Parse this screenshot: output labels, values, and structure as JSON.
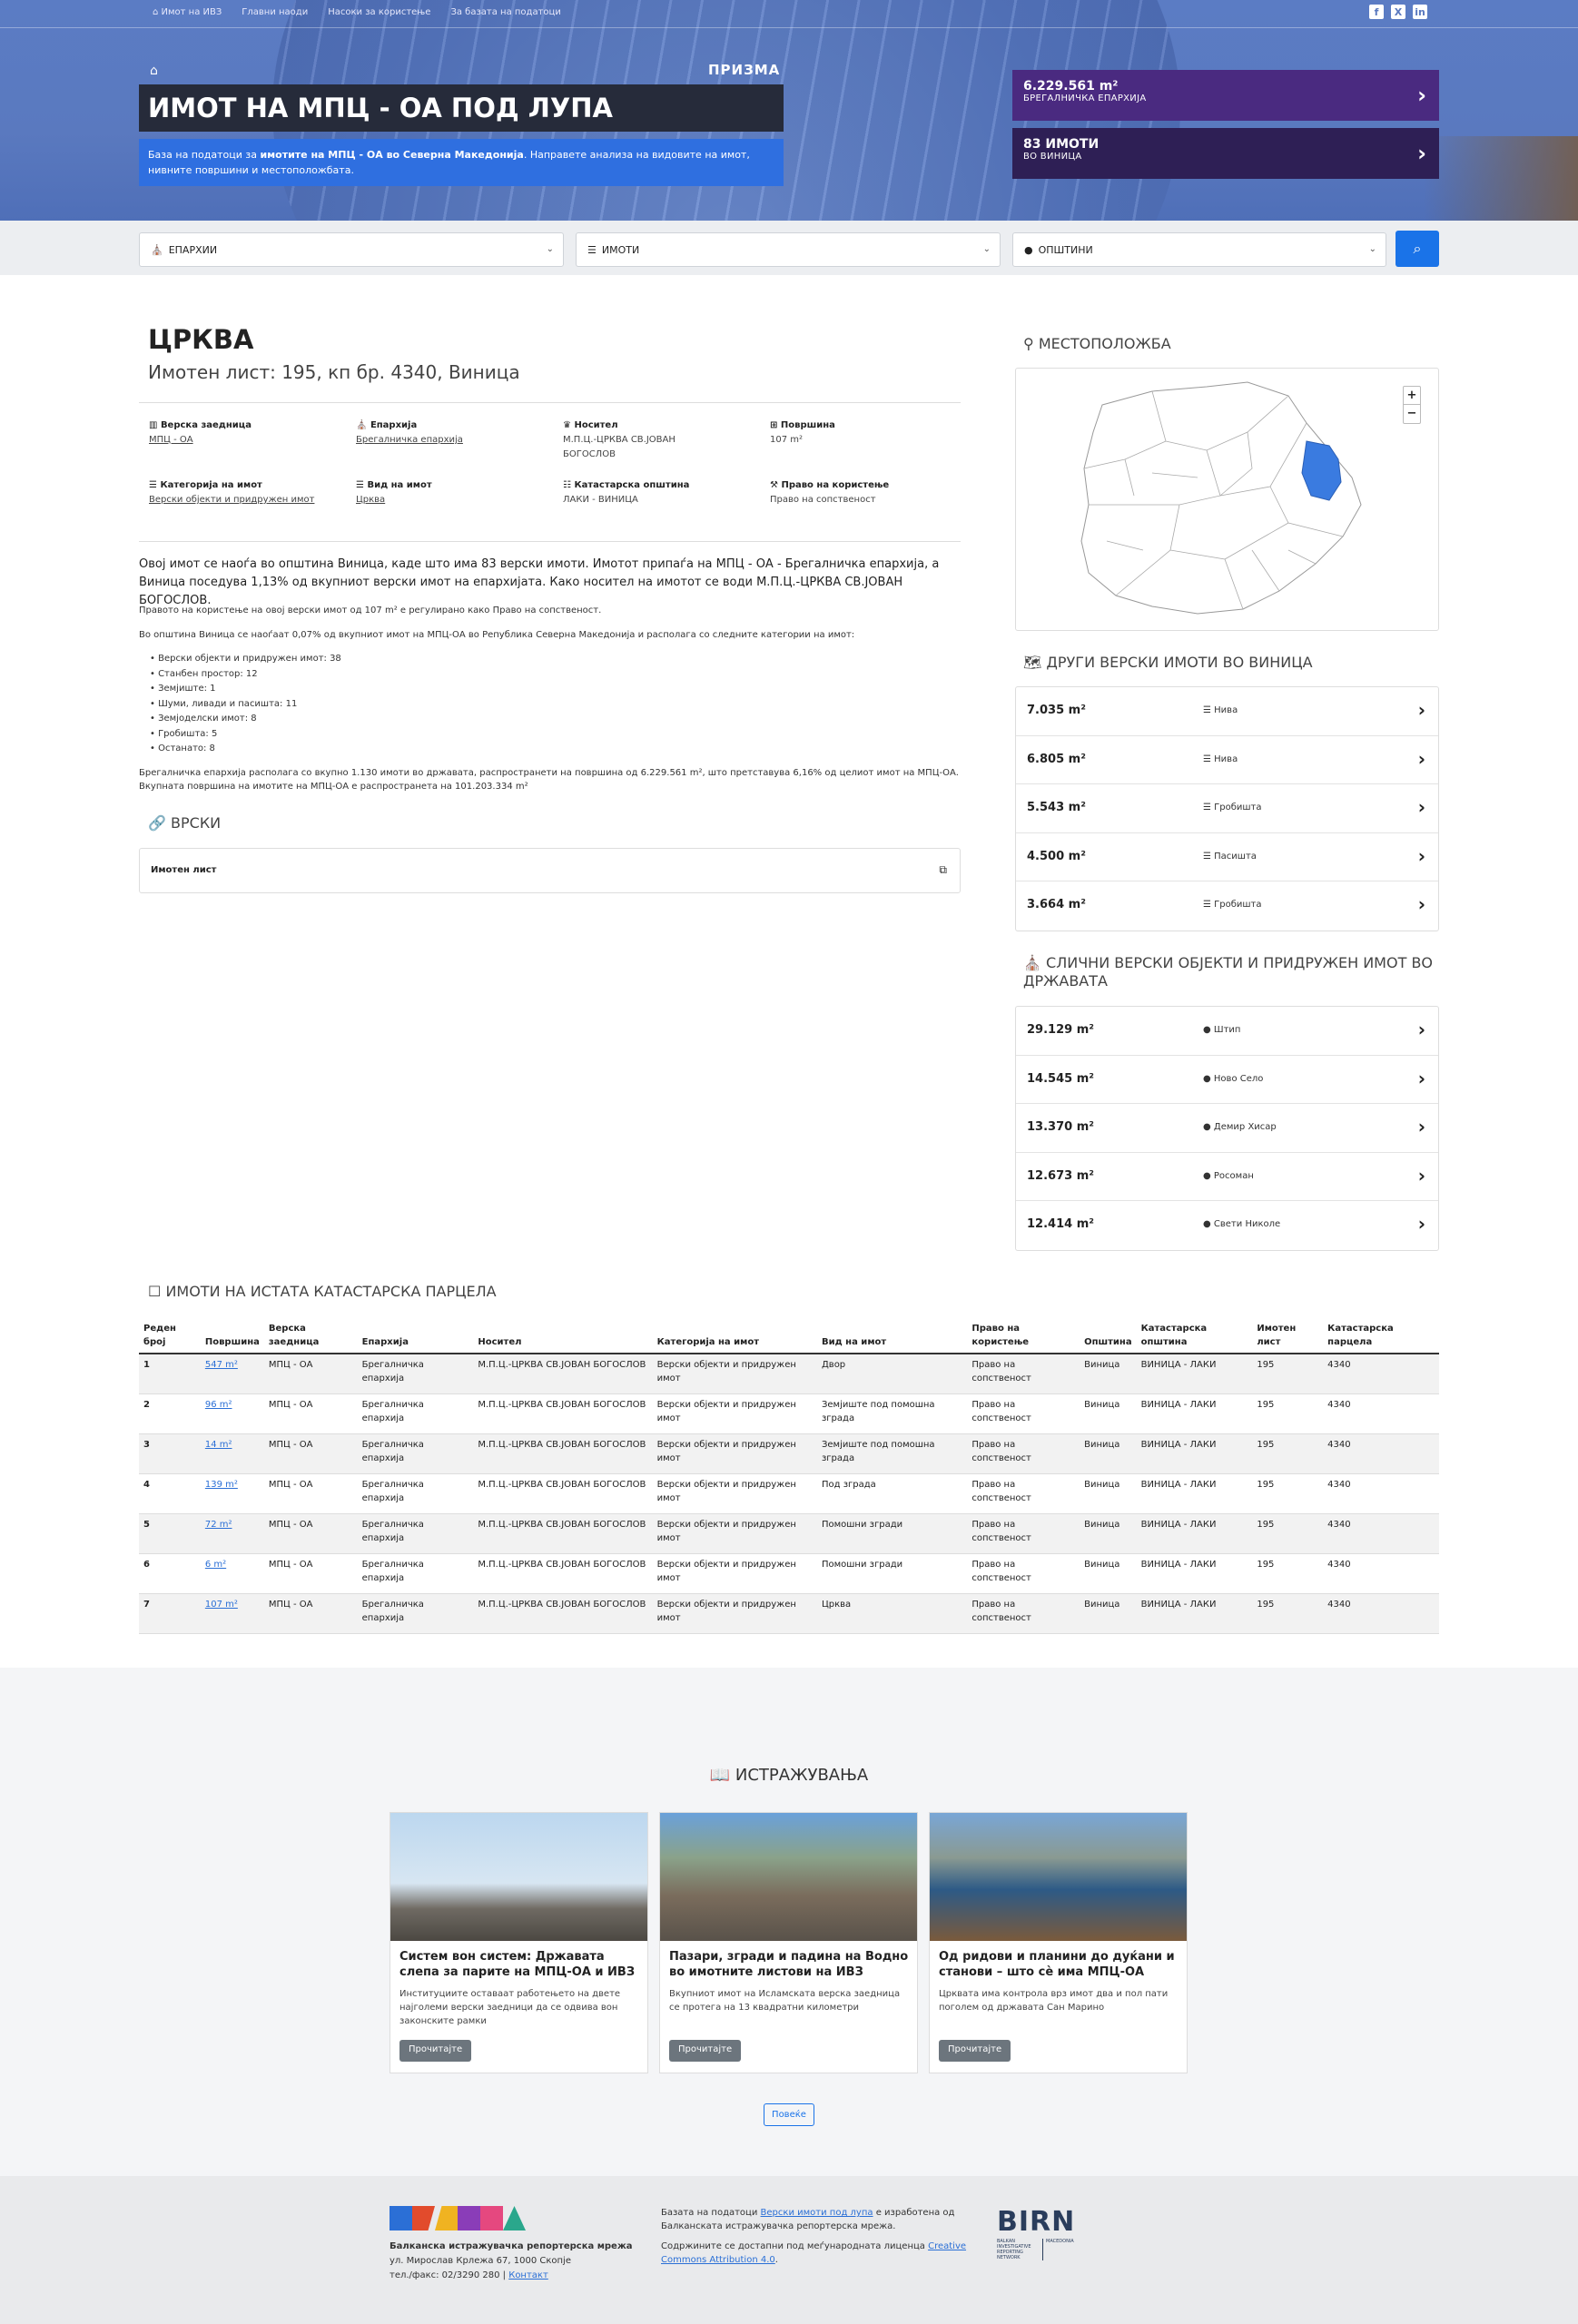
{
  "nav": {
    "items": [
      "Имот на ИВЗ",
      "Главни наоди",
      "Насоки за користење",
      "За базата на податоци"
    ]
  },
  "social": {
    "facebook": "f",
    "x": "X",
    "linkedin": "in"
  },
  "hero": {
    "logo": "ПРИЗМА",
    "title": "ИМОТ НА МПЦ - ОА ПОД ЛУПА",
    "sub_pre": "База на податоци за ",
    "sub_bold": "имотите на МПЦ - ОА во Северна Македонија",
    "sub_post": ". Направете анализа на видовите на имот, нивните површини и местоположбата."
  },
  "stats": [
    {
      "big": "6.229.561 m²",
      "small": "БРЕГАЛНИЧКА ЕПАРХИЈА"
    },
    {
      "big": "83 ИМОТИ",
      "small": "ВО ВИНИЦА"
    }
  ],
  "filters": {
    "eparhii": "ЕПАРХИИ",
    "imoti": "ИМОТИ",
    "opshtini": "ОПШТИНИ"
  },
  "property": {
    "title": "ЦРКВА",
    "subtitle": "Имотен лист: 195, кп бр. 4340, Виница",
    "fields": [
      {
        "label": "Верска заедница",
        "value": "МПЦ - ОА",
        "link": true
      },
      {
        "label": "Епархија",
        "value": "Брегалничка епархија",
        "link": true
      },
      {
        "label": "Носител",
        "value": "М.П.Ц.-ЦРКВА СВ.ЈОВАН БОГОСЛОВ",
        "link": false
      },
      {
        "label": "Површина",
        "value": "107 m²",
        "link": false
      },
      {
        "label": "Категорија на имот",
        "value": "Верски објекти и придружен имот",
        "link": true
      },
      {
        "label": "Вид на имот",
        "value": "Црква",
        "link": true
      },
      {
        "label": "Катастарска општина",
        "value": "ЛАКИ - ВИНИЦА",
        "link": false
      },
      {
        "label": "Право на користење",
        "value": "Право на сопственост",
        "link": false
      }
    ]
  },
  "desc": {
    "p1": "Овој имот се наоѓа во општина Виница, каде што има 83 верски имоти. Имотот припаѓа на МПЦ - ОА - Брегалничка епархија, а Виница поседува 1,13% од вкупниот верски имот на епархијата. Како носител на имотот се води М.П.Ц.-ЦРКВА СВ.ЈОВАН БОГОСЛОВ.",
    "p2": "Правото на користење на овој верски имот од 107 m² е регулирано како Право на сопственост.",
    "p3": "Во општина Виница се наоѓаат 0,07% од вкупниот имот на МПЦ-ОА во Република Северна Македонија и располага со следните категории на имот:",
    "categories": [
      "Верски објекти и придружен имот: 38",
      "Станбен простор: 12",
      "Земјиште: 1",
      "Шуми, ливади и пасишта: 11",
      "Земјоделски имот: 8",
      "Гробишта: 5",
      "Останато: 8"
    ],
    "p4": "Брегалничка епархија располага со вкупно 1.130 имоти во државата, распространети на површина од 6.229.561 m², што претставува 6,16% од целиот имот на МПЦ-ОА. Вкупната површина на имотите на МПЦ-ОА е распространета на 101.203.334 m²"
  },
  "links": {
    "heading": "ВРСКИ",
    "item": "Имотен лист"
  },
  "location": {
    "heading": "МЕСТОПОЛОЖБА",
    "zoom_in": "+",
    "zoom_out": "−"
  },
  "other": {
    "heading": "ДРУГИ ВЕРСКИ ИМОТИ ВО ВИНИЦА",
    "items": [
      {
        "area": "7.035 m²",
        "type": "Нива"
      },
      {
        "area": "6.805 m²",
        "type": "Нива"
      },
      {
        "area": "5.543 m²",
        "type": "Гробишта"
      },
      {
        "area": "4.500 m²",
        "type": "Пасишта"
      },
      {
        "area": "3.664 m²",
        "type": "Гробишта"
      }
    ]
  },
  "similar": {
    "heading": "СЛИЧНИ ВЕРСКИ ОБЈЕКТИ И ПРИДРУЖЕН ИМОТ ВО ДРЖАВАТА",
    "items": [
      {
        "area": "29.129 m²",
        "place": "Штип"
      },
      {
        "area": "14.545 m²",
        "place": "Ново Село"
      },
      {
        "area": "13.370 m²",
        "place": "Демир Хисар"
      },
      {
        "area": "12.673 m²",
        "place": "Росоман"
      },
      {
        "area": "12.414 m²",
        "place": "Свети Николе"
      }
    ]
  },
  "parcel": {
    "heading": "ИМОТИ НА ИСТАТА КАТАСТАРСКА ПАРЦЕЛА",
    "columns": [
      "Реден број",
      "Површина",
      "Верска заедница",
      "Епархија",
      "Носител",
      "Категорија на имот",
      "Вид на имот",
      "Право на користење",
      "Општина",
      "Катастарска општина",
      "Имотен лист",
      "Катастарска парцела"
    ],
    "rows": [
      [
        "1",
        "547 m²",
        "МПЦ - ОА",
        "Брегалничка епархија",
        "М.П.Ц.-ЦРКВА СВ.ЈОВАН БОГОСЛОВ",
        "Верски објекти и придружен имот",
        "Двор",
        "Право на сопственост",
        "Виница",
        "ВИНИЦА - ЛАКИ",
        "195",
        "4340"
      ],
      [
        "2",
        "96 m²",
        "МПЦ - ОА",
        "Брегалничка епархија",
        "М.П.Ц.-ЦРКВА СВ.ЈОВАН БОГОСЛОВ",
        "Верски објекти и придружен имот",
        "Земјиште под помошна зграда",
        "Право на сопственост",
        "Виница",
        "ВИНИЦА - ЛАКИ",
        "195",
        "4340"
      ],
      [
        "3",
        "14 m²",
        "МПЦ - ОА",
        "Брегалничка епархија",
        "М.П.Ц.-ЦРКВА СВ.ЈОВАН БОГОСЛОВ",
        "Верски објекти и придружен имот",
        "Земјиште под помошна зграда",
        "Право на сопственост",
        "Виница",
        "ВИНИЦА - ЛАКИ",
        "195",
        "4340"
      ],
      [
        "4",
        "139 m²",
        "МПЦ - ОА",
        "Брегалничка епархија",
        "М.П.Ц.-ЦРКВА СВ.ЈОВАН БОГОСЛОВ",
        "Верски објекти и придружен имот",
        "Под зграда",
        "Право на сопственост",
        "Виница",
        "ВИНИЦА - ЛАКИ",
        "195",
        "4340"
      ],
      [
        "5",
        "72 m²",
        "МПЦ - ОА",
        "Брегалничка епархија",
        "М.П.Ц.-ЦРКВА СВ.ЈОВАН БОГОСЛОВ",
        "Верски објекти и придружен имот",
        "Помошни згради",
        "Право на сопственост",
        "Виница",
        "ВИНИЦА - ЛАКИ",
        "195",
        "4340"
      ],
      [
        "6",
        "6 m²",
        "МПЦ - ОА",
        "Брегалничка епархија",
        "М.П.Ц.-ЦРКВА СВ.ЈОВАН БОГОСЛОВ",
        "Верски објекти и придружен имот",
        "Помошни згради",
        "Право на сопственост",
        "Виница",
        "ВИНИЦА - ЛАКИ",
        "195",
        "4340"
      ],
      [
        "7",
        "107 m²",
        "МПЦ - ОА",
        "Брегалничка епархија",
        "М.П.Ц.-ЦРКВА СВ.ЈОВАН БОГОСЛОВ",
        "Верски објекти и придружен имот",
        "Црква",
        "Право на сопственост",
        "Виница",
        "ВИНИЦА - ЛАКИ",
        "195",
        "4340"
      ]
    ]
  },
  "research": {
    "heading": "ИСТРАЖУВАЊА",
    "more": "Повеќе",
    "cards": [
      {
        "title": "Систем вон систем: Државата слепа за парите на МПЦ-ОА и ИВЗ",
        "text": "Институциите оставаат работењето на двете најголеми верски заедници да се одвива вон законските рамки",
        "button": "Прочитајте"
      },
      {
        "title": "Пазари, згради и падина на Водно во имотните листови на ИВЗ",
        "text": "Вкупниот имот на Исламската верска заедница се протега на 13 квадратни километри",
        "button": "Прочитајте"
      },
      {
        "title": "Од ридови и планини до дуќани и станови – што сè има МПЦ-ОА",
        "text": "Црквата има контрола врз имот два и пол пати поголем од државата Сан Марино",
        "button": "Прочитајте"
      }
    ]
  },
  "footer": {
    "org": "Балканска истражувачка репортерска мрежа",
    "address": "ул. Мирослав Крлежа 67, 1000 Скопје",
    "phone": "тел./факс: 02/3290 280 | ",
    "contact": "Контакт",
    "t1_pre": "Базата на податоци ",
    "t1_link": "Верски имоти под лупа",
    "t1_post": " е изработена од Балканската истражувачка репортерска мрежа.",
    "t2_pre": "Содржините се достапни под меѓународната лиценца ",
    "t2_link": "Creative Commons Attribution 4.0",
    "t2_post": ".",
    "birn_name": "BIRN",
    "birn_sub": "BALKAN INVESTIGATIVE REPORTING NETWORK",
    "birn_country": "MACEDONIA"
  },
  "colors": {
    "accent": "#1a73e8",
    "hero_blue": "#5a79bf",
    "stat1": "#4a2a80",
    "stat2": "#2e1f55",
    "highlight_region": "#3a7be0"
  }
}
